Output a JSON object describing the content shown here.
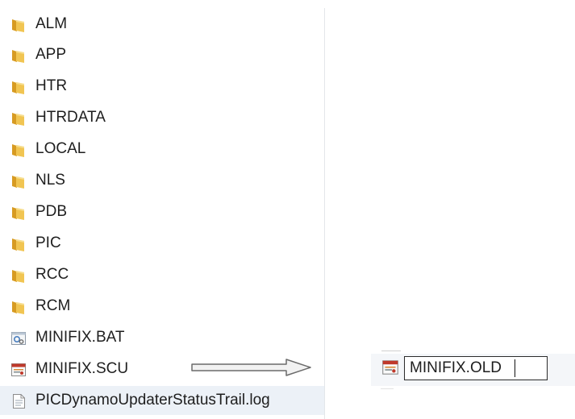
{
  "files": [
    {
      "name": "ALM",
      "icon": "folder-icon"
    },
    {
      "name": "APP",
      "icon": "folder-icon"
    },
    {
      "name": "HTR",
      "icon": "folder-icon"
    },
    {
      "name": "HTRDATA",
      "icon": "folder-icon"
    },
    {
      "name": "LOCAL",
      "icon": "folder-icon"
    },
    {
      "name": "NLS",
      "icon": "folder-icon"
    },
    {
      "name": "PDB",
      "icon": "folder-icon"
    },
    {
      "name": "PIC",
      "icon": "folder-icon"
    },
    {
      "name": "RCC",
      "icon": "folder-icon"
    },
    {
      "name": "RCM",
      "icon": "folder-icon"
    },
    {
      "name": "MINIFIX.BAT",
      "icon": "batch-file-icon"
    },
    {
      "name": "MINIFIX.SCU",
      "icon": "scu-file-icon"
    },
    {
      "name": "PICDynamoUpdaterStatusTrail.log",
      "icon": "log-file-icon"
    }
  ],
  "selected_row": "PICDynamoUpdaterStatusTrail.log",
  "rename": {
    "value": "MINIFIX.OLD",
    "icon": "scu-file-icon"
  },
  "colors": {
    "folder": "#e8b63a",
    "selection": "#ecf1f7",
    "arrow": "#6b6b6b",
    "scu_icon_red": "#c0392b"
  }
}
